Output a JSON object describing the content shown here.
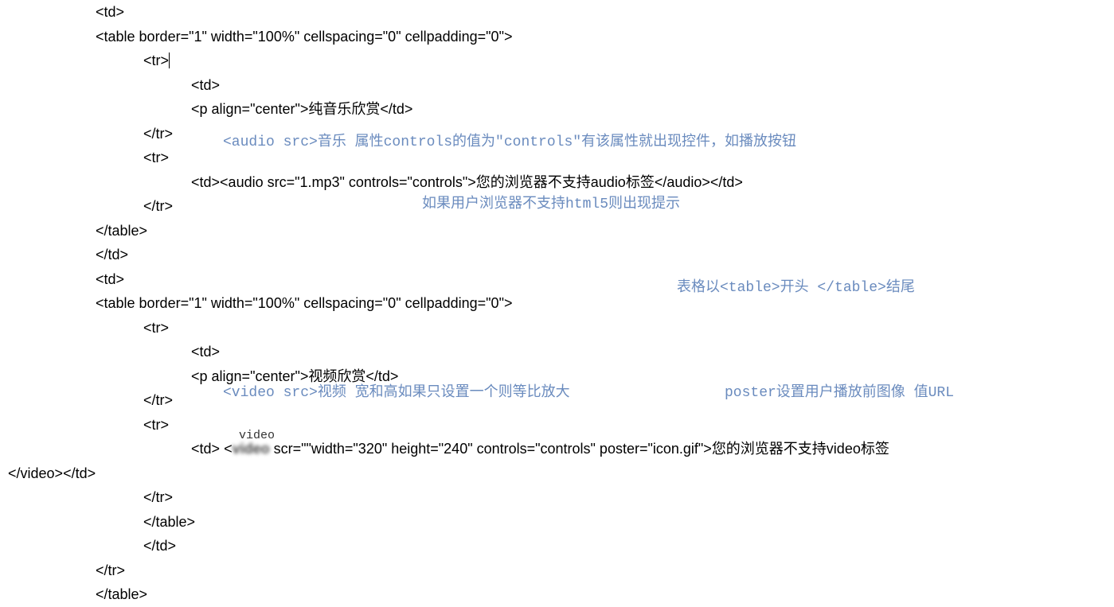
{
  "lines": {
    "l1": "<td>",
    "l2": "<table border=\"1\" width=\"100%\" cellspacing=\"0\" cellpadding=\"0\">",
    "l3": "<tr>",
    "l4": "<td>",
    "l5_a": "<p align=\"center\">",
    "l5_b": "纯音乐欣赏",
    "l5_c": "</td>",
    "l6": "</tr>",
    "l7": "<tr>",
    "l8_a": "<td>",
    "l8_b": "<audio src=\"1.mp3\" controls=\"controls\">",
    "l8_c": "您的浏览器不支持audio标签",
    "l8_d": "</audio>",
    "l8_e": "</td>",
    "l9": "</tr>",
    "l10": "</table>",
    "l11": "</td>",
    "l12": "<td>",
    "l13": "<table border=\"1\" width=\"100%\" cellspacing=\"0\" cellpadding=\"0\">",
    "l14": "<tr>",
    "l15": "<td>",
    "l16_a": "<p align=\"center\">",
    "l16_b": "视频欣赏",
    "l16_c": "</td>",
    "l17": "</tr>",
    "l18": "<tr>",
    "l19_a": "<td>",
    "l19_b": "<",
    "l19_c": " scr=\"\"width=\"320\" height=\"240\" controls=\"controls\" poster=\"icon.gif\">",
    "l19_d": "您的浏览器不支持video标签",
    "l20_a": "</video>",
    "l20_b": "</td>",
    "l21": "</tr>",
    "l22": "</table>",
    "l23": "</td>",
    "l24": "</tr>",
    "l25": "</table>"
  },
  "ruby": {
    "video_label": "video",
    "blurred_text": "video"
  },
  "comments": {
    "c1": "<audio src>音乐 属性controls的值为\"controls\"有该属性就出现控件，如播放按钮",
    "c2": "如果用户浏览器不支持html5则出现提示",
    "c3": "表格以<table>开头 </table>结尾",
    "c4": "<video src>视频 宽和高如果只设置一个则等比放大",
    "c5": "poster设置用户播放前图像 值URL"
  }
}
